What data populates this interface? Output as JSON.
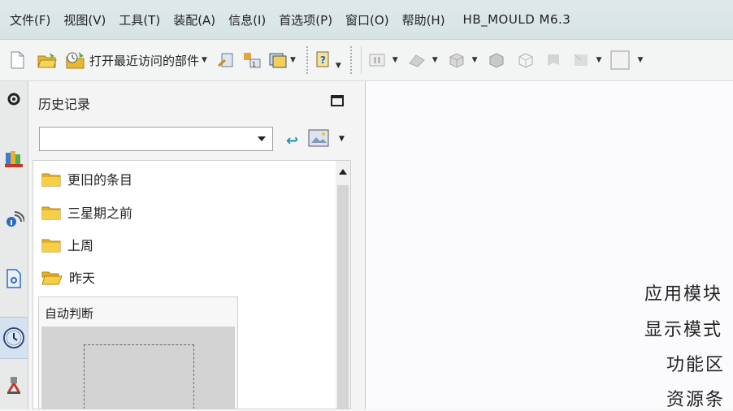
{
  "menubar": {
    "items": [
      "文件(F)",
      "视图(V)",
      "工具(T)",
      "装配(A)",
      "信息(I)",
      "首选项(P)",
      "窗口(O)",
      "帮助(H)"
    ],
    "brand": "HB_MOULD M6.3"
  },
  "toolbar": {
    "recent_parts_label": "打开最近访问的部件"
  },
  "rail": {
    "icons": [
      "gear-icon",
      "assembly-navigator-icon",
      "wifi-info-icon",
      "document-icon",
      "history-clock-icon",
      "robot-tool-icon"
    ]
  },
  "history": {
    "title": "历史记录",
    "filter_value": "",
    "groups": [
      {
        "label": "更旧的条目",
        "icon": "folder-closed"
      },
      {
        "label": "三星期之前",
        "icon": "folder-closed"
      },
      {
        "label": "上周",
        "icon": "folder-closed"
      },
      {
        "label": "昨天",
        "icon": "folder-open"
      }
    ],
    "preview_title": "自动判断"
  },
  "canvas": {
    "callouts": [
      "应用模块",
      "显示模式",
      "功能区",
      "资源条"
    ]
  },
  "colors": {
    "menubar_bg": "#d9e5e6",
    "folder": "#f2c431",
    "accent_blue": "#2e8fb5"
  }
}
